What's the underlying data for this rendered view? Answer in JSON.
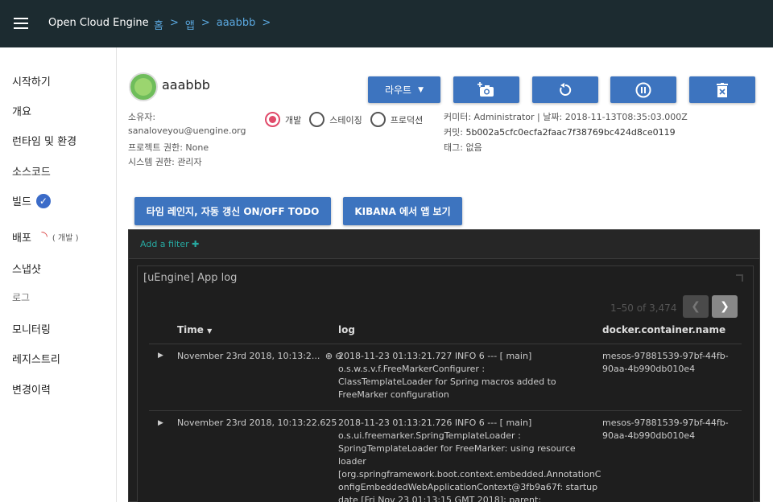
{
  "topbar": {
    "app_title": "Open Cloud Engine",
    "breadcrumbs": [
      "홈",
      ">",
      "앱",
      ">",
      "aaabbb",
      ">"
    ]
  },
  "sidebar": {
    "items": [
      {
        "label": "시작하기"
      },
      {
        "label": "개요"
      },
      {
        "label": "런타임 및 환경"
      },
      {
        "label": "소스코드"
      },
      {
        "label": "빌드",
        "status_icon": "check-icon"
      },
      {
        "label": "배포",
        "note": "( 개발 )",
        "status_icon": "spinner-icon"
      },
      {
        "label": "스냅샷"
      },
      {
        "label": "로그"
      },
      {
        "label": "모니터링"
      },
      {
        "label": "레지스트리"
      },
      {
        "label": "변경이력"
      }
    ]
  },
  "app": {
    "name": "aaabbb",
    "owner_label": "소유자:",
    "owner": "sanaloveyou@uengine.org",
    "project_perm": "프로젝트 권한: None",
    "system_perm": "시스템 권한: 관리자"
  },
  "environments": {
    "options": [
      {
        "label": "개발",
        "checked": true
      },
      {
        "label": "스테이징",
        "checked": false
      },
      {
        "label": "프로덕션",
        "checked": false
      }
    ]
  },
  "toolbar": {
    "route_label": "라우트",
    "snapshot_icon": "camera-plus-icon",
    "restart_icon": "refresh-icon",
    "pause_icon": "pause-icon",
    "delete_icon": "delete-icon"
  },
  "commit": {
    "committer": "커미터: Administrator | 날짜: 2018-11-13T08:35:03.000Z",
    "commit_label": "커밋:",
    "commit_id": "5b002a5cfc0ecfa2faac7f38769bc424d8ce0119",
    "tag_label": "태그:",
    "tag": "없음"
  },
  "actions": {
    "timelapse_label": "타임 레인지, 자동 갱신 ON/OFF TODO",
    "kibana_label": "KIBANA 에서 앱 보기"
  },
  "kibana": {
    "add_filter": "Add a filter",
    "panel_title": "[uEngine] App log",
    "pager_text": "1–50 of 3,474",
    "columns": [
      "Time",
      "log",
      "docker.container.name"
    ],
    "rows": [
      {
        "time": "November 23rd 2018, 10:13:2...",
        "log": [
          "2018-11-23 01:13:21.727  INFO 6 --- [         main]",
          "o.s.w.s.v.f.FreeMarkerConfigurer         :",
          "ClassTemplateLoader for Spring macros added to",
          "FreeMarker configuration"
        ],
        "container": [
          "mesos-97881539-97bf-44fb-",
          "90aa-4b990db010e4"
        ]
      },
      {
        "time": "November 23rd 2018, 10:13:22.625",
        "log": [
          "2018-11-23 01:13:21.726  INFO 6 --- [         main]",
          "o.s.ui.freemarker.SpringTemplateLoader   :",
          "SpringTemplateLoader for FreeMarker: using resource",
          "loader",
          "[org.springframework.boot.context.embedded.AnnotationC",
          "onfigEmbeddedWebApplicationContext@3fb9a67f: startup",
          "date [Fri Nov 23 01:13:15 GMT 2018]; parent:"
        ],
        "container": [
          "mesos-97881539-97bf-44fb-",
          "90aa-4b990db010e4"
        ]
      }
    ]
  },
  "colors": {
    "topbar_bg": "#1c2b30",
    "accent_blue": "#3d74bf",
    "radio_active": "#e04a6a",
    "kibana_bg": "#1f1f1f"
  }
}
